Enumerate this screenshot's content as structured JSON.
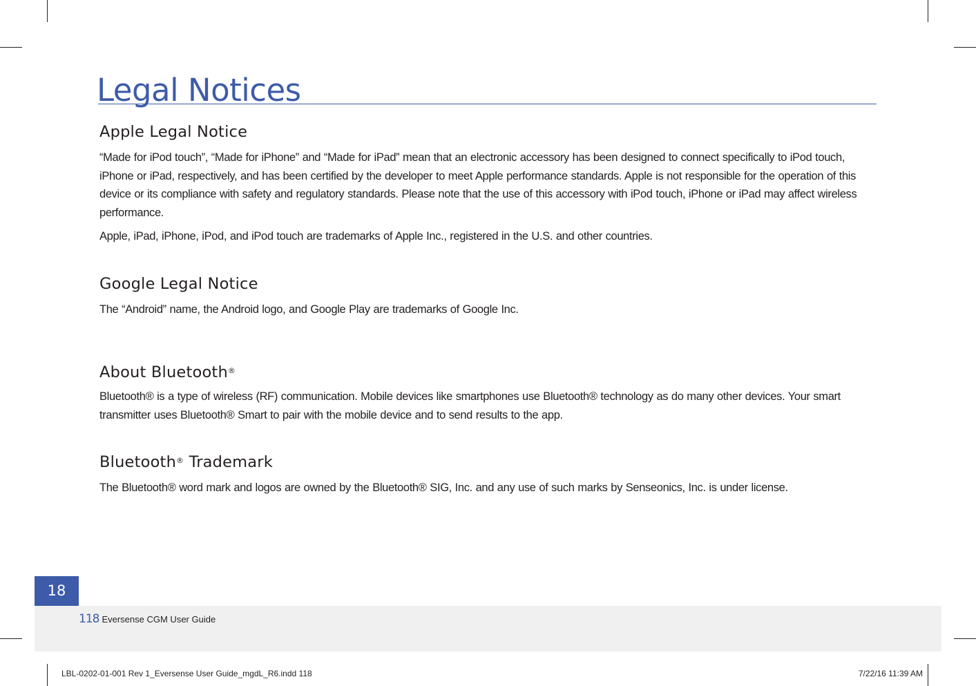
{
  "page": {
    "title": "Legal Notices",
    "tab_number": "18"
  },
  "sections": {
    "apple": {
      "heading": "Apple Legal Notice",
      "paragraphs": [
        "“Made for iPod touch”, “Made for iPhone” and “Made for iPad” mean that an electronic accessory has been designed to connect specifically to iPod touch, iPhone or iPad, respectively, and has been certified by the developer to meet Apple performance standards. Apple is not responsible for the operation of this device or its compliance with safety and regulatory standards. Please note that the use of this accessory with iPod touch, iPhone or iPad may affect wireless performance.",
        "Apple, iPad, iPhone, iPod, and iPod touch are trademarks of Apple Inc., registered in the U.S. and other countries."
      ]
    },
    "google": {
      "heading": "Google Legal Notice",
      "paragraph": "The “Android” name, the Android logo, and Google Play are trademarks of Google Inc."
    },
    "about_bluetooth": {
      "heading": "About Bluetooth",
      "registered_mark": "®",
      "paragraph": "Bluetooth® is a type of wireless (RF) communication. Mobile devices like smartphones use Bluetooth® technology as do many other devices. Your smart transmitter uses Bluetooth® Smart to pair with the mobile device and to send results to the app."
    },
    "bluetooth_trademark": {
      "heading_prefix": "Bluetooth",
      "registered_mark": "®",
      "heading_suffix": " Trademark",
      "paragraph": "The Bluetooth® word mark and logos are owned by the Bluetooth® SIG, Inc. and any use of such marks by Senseonics, Inc. is under license."
    }
  },
  "footer": {
    "page_number": "118",
    "guide_name": "Eversense CGM User Guide"
  },
  "slug": {
    "file_info": "LBL-0202-01-001 Rev 1_Eversense User Guide_mgdL_R6.indd   118",
    "timestamp": "7/22/16   11:39 AM"
  },
  "colors": {
    "accent": "#3d5ba9",
    "text": "#231f20",
    "footer_band": "#f0f0f0"
  }
}
